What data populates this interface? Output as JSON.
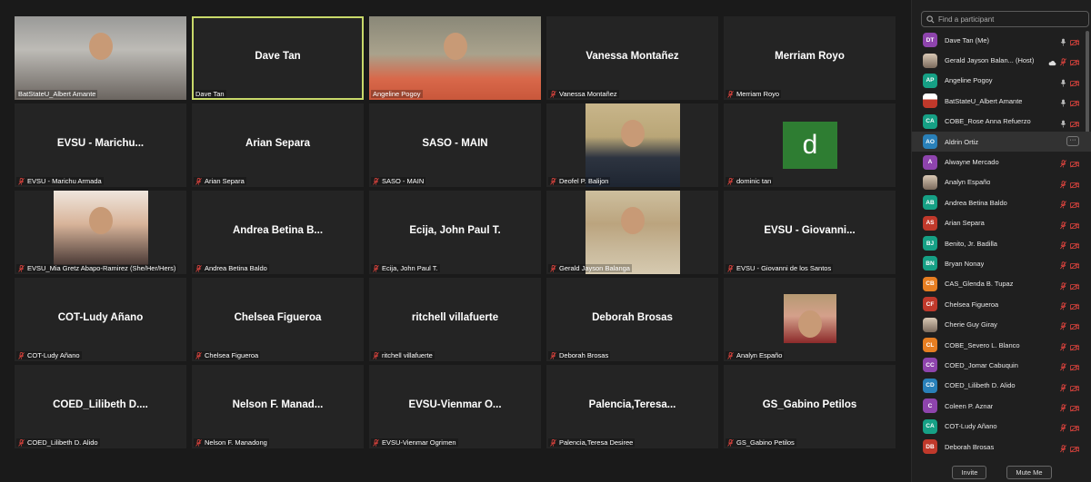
{
  "tiles": [
    {
      "name": "",
      "label": "BatStateU_Albert Amante",
      "photo": "p-amante"
    },
    {
      "name": "Dave Tan",
      "label": "Dave Tan",
      "active": true
    },
    {
      "name": "",
      "label": "Angeline Pogoy",
      "photo": "p-pogoy"
    },
    {
      "name": "Vanessa Montañez",
      "label": "Vanessa Montañez",
      "muted": true
    },
    {
      "name": "Merriam Royo",
      "label": "Merriam Royo",
      "muted": true
    },
    {
      "name": "EVSU - Marichu...",
      "label": "EVSU - Marichu Armada",
      "muted": true
    },
    {
      "name": "Arian Separa",
      "label": "Arian Separa",
      "muted": true
    },
    {
      "name": "SASO - MAIN",
      "label": "SASO - MAIN",
      "muted": true
    },
    {
      "name": "",
      "label": "Deofel P. Balijon",
      "muted": true,
      "photo": "p-ballijon"
    },
    {
      "name": "",
      "label": "dominic tan",
      "muted": true,
      "avatar": "d"
    },
    {
      "name": "",
      "label": "EVSU_Mia Gretz Abapo-Ramirez (She/Her/Hers)",
      "muted": true,
      "photo": "p-abapo"
    },
    {
      "name": "Andrea Betina B...",
      "label": "Andrea Betina Baldo",
      "muted": true
    },
    {
      "name": "Ecija, John Paul T.",
      "label": "Ecija, John Paul T.",
      "muted": true
    },
    {
      "name": "",
      "label": "Gerald Jayson Balanga",
      "muted": true,
      "photo": "p-balanga"
    },
    {
      "name": "EVSU - Giovanni...",
      "label": "EVSU - Giovanni de los Santos",
      "muted": true
    },
    {
      "name": "COT-Ludy Añano",
      "label": "COT-Ludy Añano",
      "muted": true
    },
    {
      "name": "Chelsea Figueroa",
      "label": "Chelsea Figueroa",
      "muted": true
    },
    {
      "name": "ritchell villafuerte",
      "label": "ritchell villafuerte",
      "muted": true
    },
    {
      "name": "Deborah Brosas",
      "label": "Deborah Brosas",
      "muted": true
    },
    {
      "name": "",
      "label": "Analyn Españo",
      "muted": true,
      "photo": "p-espano"
    },
    {
      "name": "COED_Lilibeth D....",
      "label": "COED_Lilibeth D. Alido",
      "muted": true
    },
    {
      "name": "Nelson F. Manad...",
      "label": "Nelson F. Manadong",
      "muted": true
    },
    {
      "name": "EVSU-Vienmar O...",
      "label": "EVSU-Vienmar Ogrimen",
      "muted": true
    },
    {
      "name": "Palencia,Teresa...",
      "label": "Palencia,Teresa Desiree",
      "muted": true
    },
    {
      "name": "GS_Gabino Petilos",
      "label": "GS_Gabino Petilos",
      "muted": true
    }
  ],
  "panel": {
    "search_placeholder": "Find a participant",
    "participants": [
      {
        "initials": "DT",
        "color": "#8e44ad",
        "name": "Dave Tan (Me)",
        "mic": "on"
      },
      {
        "initials": "",
        "color": "",
        "name": "Gerald Jayson Balan... (Host)",
        "mic": "muted",
        "extra": "cloud",
        "photo": true
      },
      {
        "initials": "AP",
        "color": "#16a085",
        "name": "Angeline Pogoy",
        "mic": "on"
      },
      {
        "initials": "",
        "color": "#c0392b",
        "name": "BatStateU_Albert Amante",
        "mic": "on",
        "photo": true
      },
      {
        "initials": "CA",
        "color": "#16a085",
        "name": "COBE_Rose Anna Refuerzo",
        "mic": "on"
      },
      {
        "initials": "AO",
        "color": "#2980b9",
        "name": "Aldrin Ortiz",
        "mic": "more",
        "highlight": true
      },
      {
        "initials": "A",
        "color": "#8e44ad",
        "name": "Alwayne Mercado",
        "mic": "muted"
      },
      {
        "initials": "",
        "color": "",
        "name": "Analyn Españo",
        "mic": "muted",
        "photo": true
      },
      {
        "initials": "AB",
        "color": "#16a085",
        "name": "Andrea Betina Baldo",
        "mic": "muted"
      },
      {
        "initials": "AS",
        "color": "#c0392b",
        "name": "Arian Separa",
        "mic": "muted"
      },
      {
        "initials": "BJ",
        "color": "#16a085",
        "name": "Benito, Jr. Badilla",
        "mic": "muted"
      },
      {
        "initials": "BN",
        "color": "#16a085",
        "name": "Bryan Nonay",
        "mic": "muted"
      },
      {
        "initials": "CB",
        "color": "#e67e22",
        "name": "CAS_Glenda B. Tupaz",
        "mic": "muted"
      },
      {
        "initials": "CF",
        "color": "#c0392b",
        "name": "Chelsea Figueroa",
        "mic": "muted"
      },
      {
        "initials": "",
        "color": "",
        "name": "Cherie Guy Giray",
        "mic": "muted",
        "photo": true
      },
      {
        "initials": "CL",
        "color": "#e67e22",
        "name": "COBE_Severo L. Blanco",
        "mic": "muted"
      },
      {
        "initials": "CC",
        "color": "#8e44ad",
        "name": "COED_Jomar Cabuquin",
        "mic": "muted"
      },
      {
        "initials": "CD",
        "color": "#2980b9",
        "name": "COED_Lilibeth D. Alido",
        "mic": "muted"
      },
      {
        "initials": "C",
        "color": "#8e44ad",
        "name": "Coleen P. Aznar",
        "mic": "muted"
      },
      {
        "initials": "CA",
        "color": "#16a085",
        "name": "COT-Ludy Añano",
        "mic": "muted"
      },
      {
        "initials": "DB",
        "color": "#c0392b",
        "name": "Deborah Brosas",
        "mic": "muted"
      }
    ],
    "invite_label": "Invite",
    "mute_me_label": "Mute Me"
  },
  "icons": {
    "search": "search-icon",
    "mic_muted": "mic-muted-icon",
    "video_off": "video-off-icon",
    "mic_on": "mic-icon",
    "more": "more-icon"
  },
  "colors": {
    "muted_red": "#e0443e",
    "active_border": "#c9d96a"
  }
}
